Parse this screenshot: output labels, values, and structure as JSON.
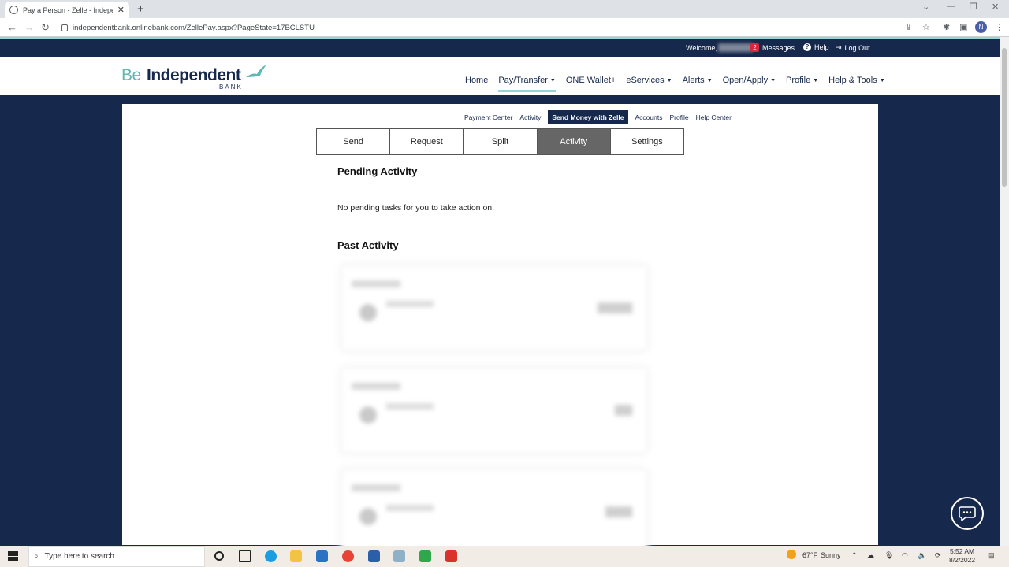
{
  "browser": {
    "tab_title": "Pay a Person - Zelle - Independe",
    "url": "independentbank.onlinebank.com/ZellePay.aspx?PageState=17BCLSTU",
    "profile_initial": "N"
  },
  "topbar": {
    "welcome": "Welcome,",
    "messages_count": "2",
    "messages": "Messages",
    "help": "Help",
    "logout": "Log Out"
  },
  "logo": {
    "be": "Be",
    "independent": "Independent",
    "bank": "BANK"
  },
  "mainnav": [
    "Home",
    "Pay/Transfer",
    "ONE Wallet+",
    "eServices",
    "Alerts",
    "Open/Apply",
    "Profile",
    "Help & Tools"
  ],
  "subnav": {
    "payment_center": "Payment Center",
    "activity": "Activity",
    "zelle": "Send Money with Zelle",
    "accounts": "Accounts",
    "profile": "Profile",
    "help_center": "Help Center"
  },
  "tabs": [
    "Send",
    "Request",
    "Split",
    "Activity",
    "Settings"
  ],
  "selected_tab": "Activity",
  "pending": {
    "heading": "Pending Activity",
    "empty_text": "No pending tasks for you to take action on."
  },
  "past": {
    "heading": "Past Activity"
  },
  "taskbar": {
    "search_placeholder": "Type here to search",
    "temperature": "67°F",
    "weather": "Sunny",
    "time": "5:52 AM",
    "date": "8/2/2022"
  },
  "colors": {
    "navy": "#16284c",
    "teal": "#9ad3d0",
    "tab_selected": "#666666"
  }
}
